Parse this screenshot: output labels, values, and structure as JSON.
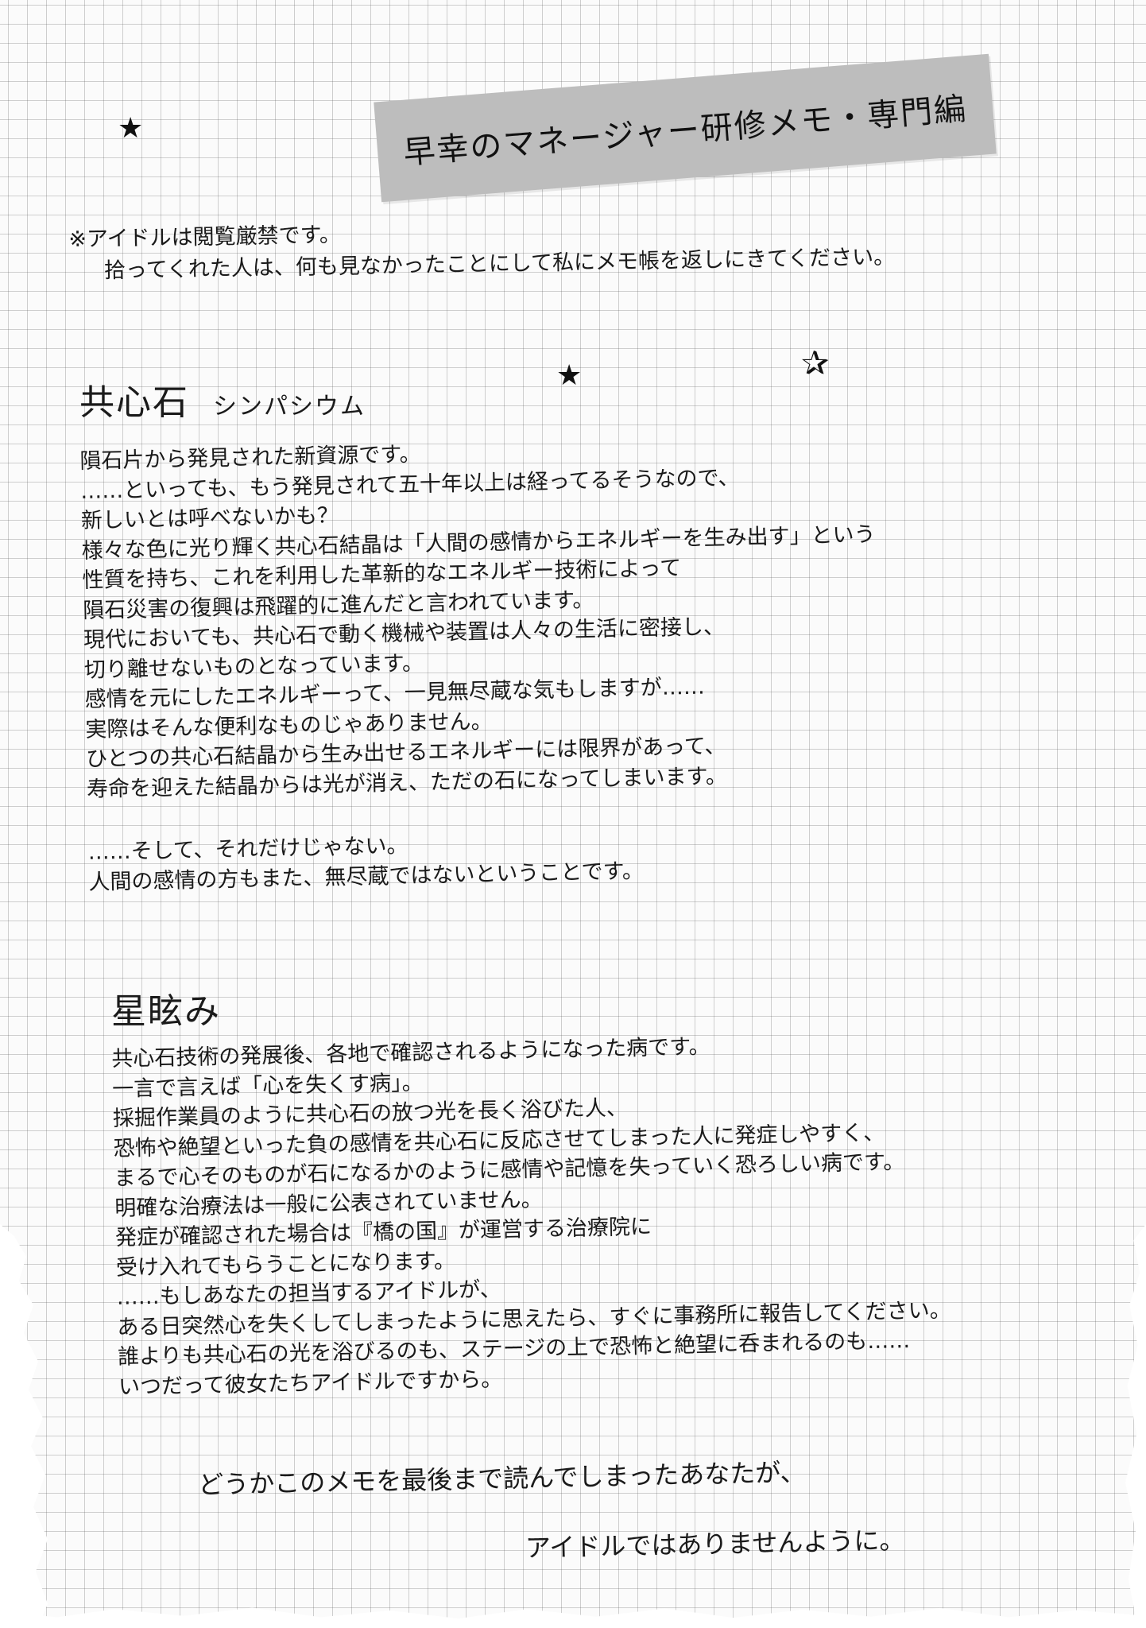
{
  "title": "早幸のマネージャー研修メモ・専門編",
  "decorations": {
    "star_filled": "★",
    "star_outline": "✰"
  },
  "notice": {
    "line1": "※アイドルは閲覧厳禁です。",
    "line2": "拾ってくれた人は、何も見なかったことにして私にメモ帳を返しにきてください。"
  },
  "section1": {
    "heading": "共心石",
    "reading": "シンパシウム",
    "lines": [
      "隕石片から発見された新資源です。",
      "……といっても、もう発見されて五十年以上は経ってるそうなので、",
      "新しいとは呼べないかも？",
      "様々な色に光り輝く共心石結晶は「人間の感情からエネルギーを生み出す」という",
      "性質を持ち、これを利用した革新的なエネルギー技術によって",
      "隕石災害の復興は飛躍的に進んだと言われています。",
      "現代においても、共心石で動く機械や装置は人々の生活に密接し、",
      "切り離せないものとなっています。",
      "感情を元にしたエネルギーって、一見無尽蔵な気もしますが……",
      "実際はそんな便利なものじゃありません。",
      "ひとつの共心石結晶から生み出せるエネルギーには限界があって、",
      "寿命を迎えた結晶からは光が消え、ただの石になってしまいます。"
    ],
    "lines_after": [
      "……そして、それだけじゃない。",
      "人間の感情の方もまた、無尽蔵ではないということです。"
    ]
  },
  "section2": {
    "heading": "星眩み",
    "lines": [
      "共心石技術の発展後、各地で確認されるようになった病です。",
      "一言で言えば「心を失くす病」。",
      "採掘作業員のように共心石の放つ光を長く浴びた人、",
      "恐怖や絶望といった負の感情を共心石に反応させてしまった人に発症しやすく、",
      "まるで心そのものが石になるかのように感情や記憶を失っていく恐ろしい病です。",
      "明確な治療法は一般に公表されていません。",
      "発症が確認された場合は『橋の国』が運営する治療院に",
      "受け入れてもらうことになります。",
      "……もしあなたの担当するアイドルが、",
      "ある日突然心を失くしてしまったように思えたら、すぐに事務所に報告してください。",
      "誰よりも共心石の光を浴びるのも、ステージの上で恐怖と絶望に呑まれるのも……",
      "いつだって彼女たちアイドルですから。"
    ]
  },
  "closing": {
    "line1": "どうかこのメモを最後まで読んでしまったあなたが、",
    "line2": "アイドルではありませんように。"
  }
}
